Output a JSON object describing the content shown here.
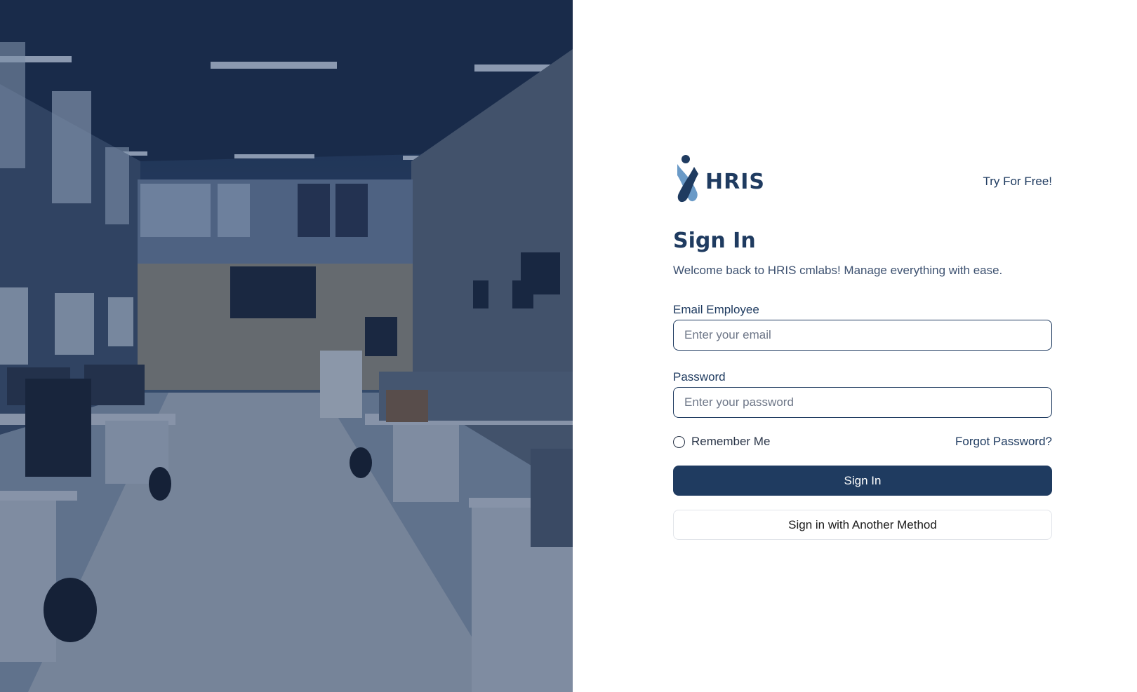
{
  "hero": {
    "image_icon": "office-photo"
  },
  "brand": {
    "logo_icon": "hris-figure-icon",
    "logo_text": "HRIS",
    "try_link": "Try For Free!"
  },
  "form": {
    "title": "Sign In",
    "subtitle": "Welcome back to HRIS cmlabs! Manage everything with ease.",
    "email_label": "Email Employee",
    "email_placeholder": "Enter your email",
    "email_value": "",
    "password_label": "Password",
    "password_placeholder": "Enter your password",
    "password_value": "",
    "remember_label": "Remember Me",
    "remember_checked": false,
    "forgot_label": "Forgot Password?",
    "signin_button": "Sign In",
    "alt_method_button": "Sign in with Another Method"
  },
  "colors": {
    "primary": "#1f3b60",
    "accent_light": "#6a9ac7",
    "background": "#ffffff"
  }
}
